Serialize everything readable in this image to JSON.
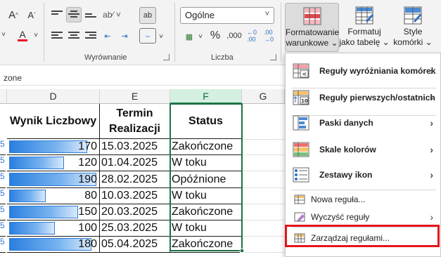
{
  "ribbon": {
    "number_format": "Ogólne",
    "groups": {
      "alignment": "Wyrównanie",
      "number": "Liczba"
    },
    "percent_symbol": "%",
    "thousands_symbol": ",000",
    "conditional_formatting": "Formatowanie warunkowe",
    "format_as_table": "Formatuj jako tabelę",
    "cell_styles": "Style komórki",
    "dropdown_arrow": "⌄"
  },
  "name_box_fragment": "zone",
  "columns": {
    "D": "D",
    "E": "E",
    "F": "F",
    "G": "G"
  },
  "table": {
    "headers": {
      "score": "Wynik Liczbowy",
      "deadline": "Termin Realizacji",
      "status": "Status"
    },
    "rows": [
      {
        "score": 170,
        "deadline": "15.03.2025",
        "status": "Zakończone"
      },
      {
        "score": 120,
        "deadline": "01.04.2025",
        "status": "W toku"
      },
      {
        "score": 190,
        "deadline": "28.02.2025",
        "status": "Opóźnione"
      },
      {
        "score": 80,
        "deadline": "10.03.2025",
        "status": "W toku"
      },
      {
        "score": 150,
        "deadline": "20.03.2025",
        "status": "Zakończone"
      },
      {
        "score": 100,
        "deadline": "25.03.2025",
        "status": "W toku"
      },
      {
        "score": 180,
        "deadline": "05.04.2025",
        "status": "Zakończone"
      }
    ],
    "databar_max": 190,
    "row_stub_char": "5"
  },
  "menu": {
    "items": [
      {
        "label": "Reguły wyróżniania komórek",
        "icon": "highlight-rules-icon",
        "submenu": true
      },
      {
        "label": "Reguły pierwszych/ostatnich",
        "icon": "top-bottom-rules-icon",
        "submenu": true
      },
      {
        "label": "Paski danych",
        "icon": "data-bars-icon",
        "submenu": true
      },
      {
        "label": "Skale kolorów",
        "icon": "color-scales-icon",
        "submenu": true
      },
      {
        "label": "Zestawy ikon",
        "icon": "icon-sets-icon",
        "submenu": true
      },
      {
        "label": "Nowa reguła...",
        "icon": "new-rule-icon",
        "submenu": false
      },
      {
        "label": "Wyczyść reguły",
        "icon": "clear-rules-icon",
        "submenu": true
      },
      {
        "label": "Zarządzaj regułami...",
        "icon": "manage-rules-icon",
        "submenu": false
      }
    ],
    "arrow": "›",
    "highlighted_item": "Zarządzaj regułami..."
  },
  "colors": {
    "highlight_border": "#e3161c",
    "selection_green": "#1e7145",
    "databar": "#2a7fe0"
  }
}
